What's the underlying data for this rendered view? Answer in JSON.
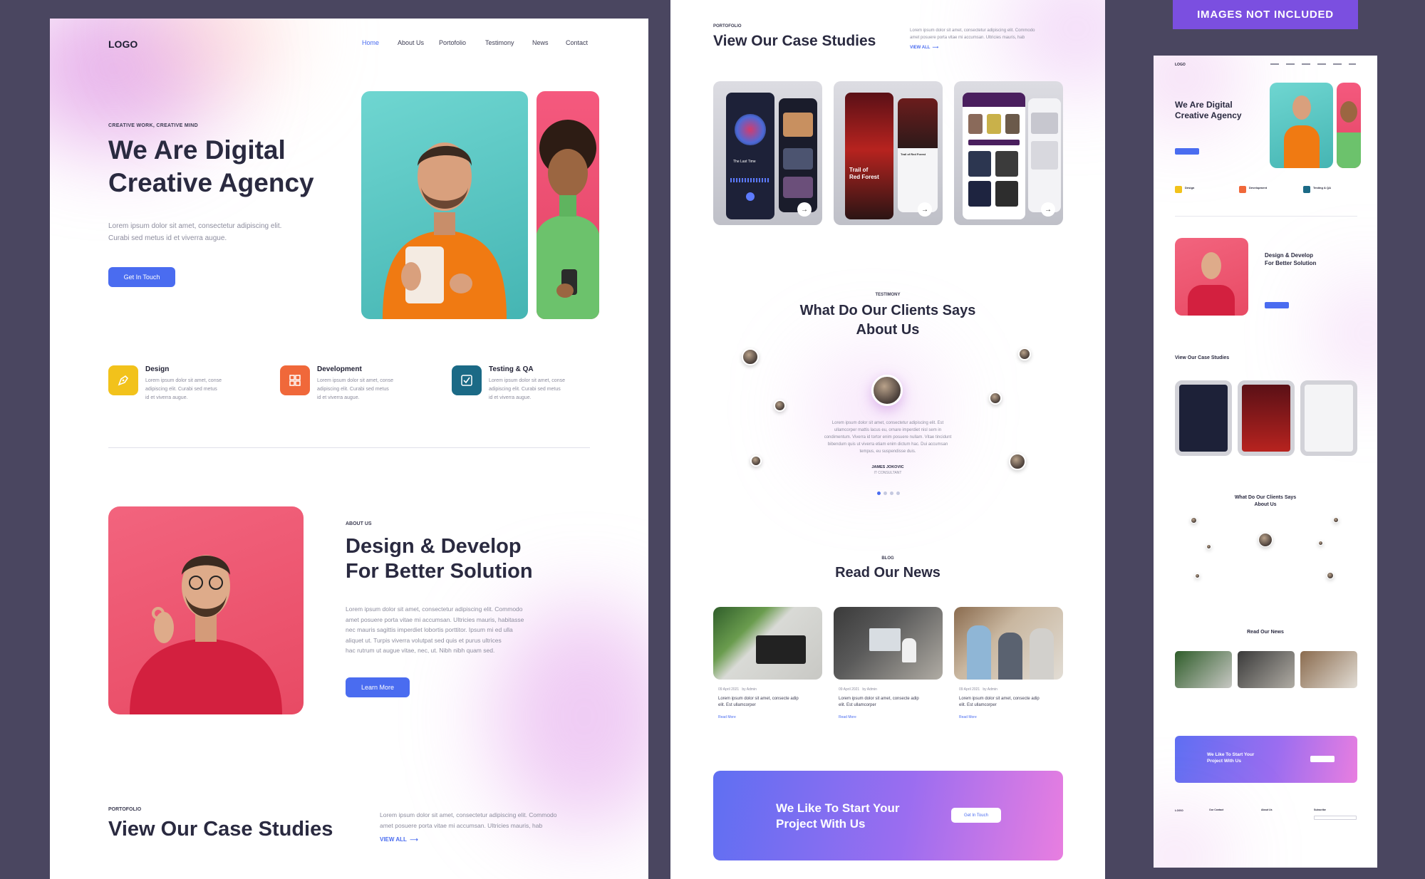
{
  "panel1": {
    "logo": "LOGO",
    "nav": [
      "Home",
      "About Us",
      "Portofolio",
      "Testimony",
      "News",
      "Contact"
    ],
    "hero": {
      "kicker": "CREATIVE WORK, CREATIVE MIND",
      "title_line1": "We Are Digital",
      "title_line2": "Creative Agency",
      "desc_line1": "Lorem ipsum dolor sit amet, consectetur adipiscing elit.",
      "desc_line2": "Curabi sed metus id et viverra augue.",
      "button": "Get In Touch"
    },
    "services": [
      {
        "title": "Design",
        "text1": "Lorem ipsum dolor sit amet, conse",
        "text2": "adipiscing elit. Curabi sed metus",
        "text3": "id et viverra augue.",
        "color": "#f2c21b"
      },
      {
        "title": "Development",
        "text1": "Lorem ipsum dolor sit amet, conse",
        "text2": "adipiscing elit. Curabi sed metus",
        "text3": "id et viverra augue.",
        "color": "#f0683a"
      },
      {
        "title": "Testing & QA",
        "text1": "Lorem ipsum dolor sit amet, conse",
        "text2": "adipiscing elit. Curabi sed metus",
        "text3": "id et viverra augue.",
        "color": "#1b6a86"
      }
    ],
    "about": {
      "kicker": "ABOUT US",
      "title_line1": "Design & Develop",
      "title_line2": "For Better Solution",
      "p1": "Lorem ipsum dolor sit amet, consectetur adipiscing elit. Commodo",
      "p2": "amet posuere porta vitae mi accumsan. Ultricies mauris, habitasse",
      "p3": "nec mauris sagittis imperdiet lobortis porttitor. Ipsum mi ed ulla",
      "p4": "aliquet ut. Turpis viverra volutpat sed quis et purus ultrices",
      "p5": "hac rutrum ut augue vitae, nec, ut. Nibh nibh quam sed.",
      "button": "Learn More"
    },
    "portfolio": {
      "kicker": "PORTOFOLIO",
      "title": "View Our Case Studies",
      "desc1": "Lorem ipsum dolor sit amet, consectetur adipiscing elit. Commodo",
      "desc2": "amet posuere porta vitae mi accumsan. Ultricies mauris, hab",
      "view_all": "VIEW ALL"
    }
  },
  "panel2": {
    "kicker": "PORTOFOLIO",
    "title": "View Our Case Studies",
    "desc1": "Lorem ipsum dolor sit amet, consectetur adipiscing elit. Commodo",
    "desc2": "amet posuere porta vitae mi accumsan. Ultricies mauris, hab",
    "view_all": "VIEW ALL",
    "case1_song": "The Last Time",
    "case2_title1": "Trail of",
    "case2_title2": "Red Forest",
    "case2_side": "Trail of Red Forest",
    "testimony": {
      "kicker": "TESTIMONY",
      "title_line1": "What Do Our Clients Says",
      "title_line2": "About Us",
      "q1": "Lorem ipsum dolor sit amet, consectetur adipiscing elit. Est",
      "q2": "ullamcorper mattis lacus eu, ornare imperdiet nisl sem in",
      "q3": "condimentum. Viverra id tortor enim posuere nullam. Vitae tincidunt",
      "q4": "bibendum quis ut viverra etiam enim dictum hac. Dui accumsan",
      "q5": "tempus, eu suspendisse duis.",
      "name": "JAMES JOKOVIC",
      "role": "IT CONSULTANT"
    },
    "blog": {
      "kicker": "BLOG",
      "title": "Read Our News",
      "posts": [
        {
          "date": "09 April 2021",
          "by": "by Admin",
          "t1": "Lorem ipsum dolor sit amet, consecte adip",
          "t2": "elit. Est ullamcorper",
          "more": "Read More"
        },
        {
          "date": "09 April 2021",
          "by": "by Admin",
          "t1": "Lorem ipsum dolor sit amet, consecte adip",
          "t2": "elit. Est ullamcorper",
          "more": "Read More"
        },
        {
          "date": "09 April 2021",
          "by": "by Admin",
          "t1": "Lorem ipsum dolor sit amet, consecte adip",
          "t2": "elit. Est ullamcorper",
          "more": "Read More"
        }
      ]
    },
    "cta": {
      "line1": "We Like To Start Your",
      "line2": "Project With Us",
      "button": "Get In Touch"
    }
  },
  "panel3": {
    "badge": "IMAGES NOT INCLUDED",
    "logo": "LOGO",
    "hero_title1": "We Are Digital",
    "hero_title2": "Creative Agency",
    "svc": [
      "Design",
      "Development",
      "Testing & QA"
    ],
    "about_title1": "Design & Develop",
    "about_title2": "For Better Solution",
    "portfolio_title": "View Our Case Studies",
    "testimony_title1": "What Do Our Clients Says",
    "testimony_title2": "About Us",
    "news_title": "Read Our News",
    "cta1": "We Like To Start Your",
    "cta2": "Project With Us",
    "footer_logo": "LOGO",
    "footer_cols": [
      "Our Contact",
      "About Us",
      "Subscribe"
    ]
  }
}
